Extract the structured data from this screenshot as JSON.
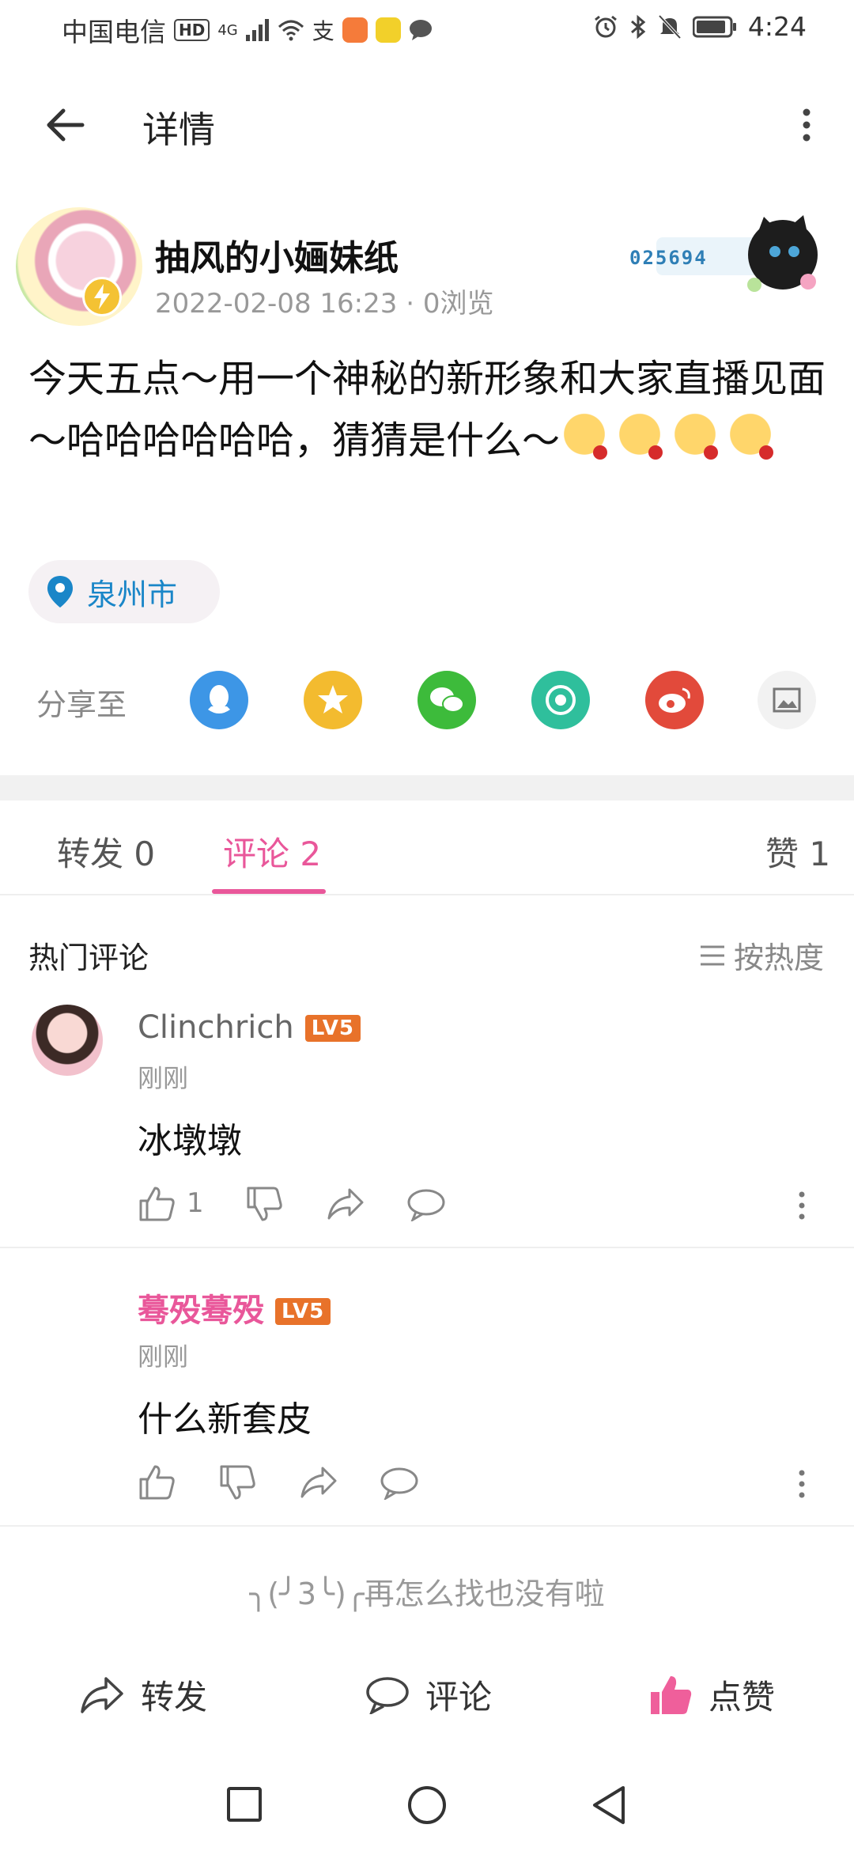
{
  "status_bar": {
    "carrier": "中国电信",
    "hd": "HD",
    "network": "4G",
    "time": "4:24"
  },
  "header": {
    "title": "详情"
  },
  "post": {
    "author": "抽风的小婳妹纸",
    "datetime": "2022-02-08 16:23",
    "views": "0浏览",
    "medal_number": "025694",
    "text": "今天五点～用一个神秘的新形象和大家直播见面～哈哈哈哈哈哈，猜猜是什么～",
    "emoji_count": 4,
    "location": "泉州市"
  },
  "share": {
    "label": "分享至",
    "targets": [
      "qq-icon",
      "qzone-icon",
      "wechat-icon",
      "moments-icon",
      "weibo-icon",
      "gallery-icon"
    ]
  },
  "tabs": [
    {
      "label": "转发 0"
    },
    {
      "label": "评论 2"
    },
    {
      "label": "赞 1"
    }
  ],
  "comments_section": {
    "title": "热门评论",
    "sort_label": "按热度"
  },
  "comments": [
    {
      "name": "Clinchrich",
      "level": "LV5",
      "time": "刚刚",
      "text": "冰墩墩",
      "likes": "1"
    },
    {
      "name": "蓦殁蓦殁",
      "level": "LV5",
      "time": "刚刚",
      "text": "什么新套皮",
      "likes": ""
    }
  ],
  "end_message": "╮(╯3╰)╭再怎么找也没有啦",
  "bottom_bar": {
    "repost": "转发",
    "comment": "评论",
    "like": "点赞"
  },
  "colors": {
    "accent_pink": "#e9579a",
    "location_blue": "#1a86c8",
    "level_orange": "#e8722a"
  }
}
